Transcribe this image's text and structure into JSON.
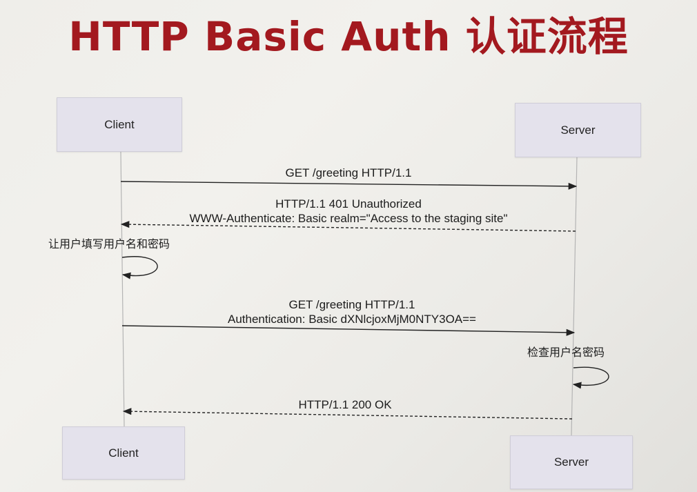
{
  "title": "HTTP Basic Auth 认证流程",
  "participants": {
    "client": "Client",
    "server": "Server"
  },
  "messages": [
    {
      "lines": [
        "GET /greeting HTTP/1.1"
      ],
      "direction": "client-to-server",
      "style": "solid"
    },
    {
      "lines": [
        "HTTP/1.1 401 Unauthorized",
        "WWW-Authenticate: Basic realm=\"Access to the staging site\""
      ],
      "direction": "server-to-client",
      "style": "dashed"
    },
    {
      "lines": [
        "让用户填写用户名和密码"
      ],
      "direction": "self-client",
      "style": "solid"
    },
    {
      "lines": [
        "GET /greeting HTTP/1.1",
        "Authentication: Basic dXNlcjoxMjM0NTY3OA=="
      ],
      "direction": "client-to-server",
      "style": "solid"
    },
    {
      "lines": [
        "检查用户名密码"
      ],
      "direction": "self-server",
      "style": "solid"
    },
    {
      "lines": [
        "HTTP/1.1 200 OK"
      ],
      "direction": "server-to-client",
      "style": "dashed"
    }
  ],
  "colors": {
    "title": "#a3191f",
    "actor_fill": "#e4e2ec",
    "lifeline": "#b4b4b4",
    "arrow": "#222222"
  }
}
